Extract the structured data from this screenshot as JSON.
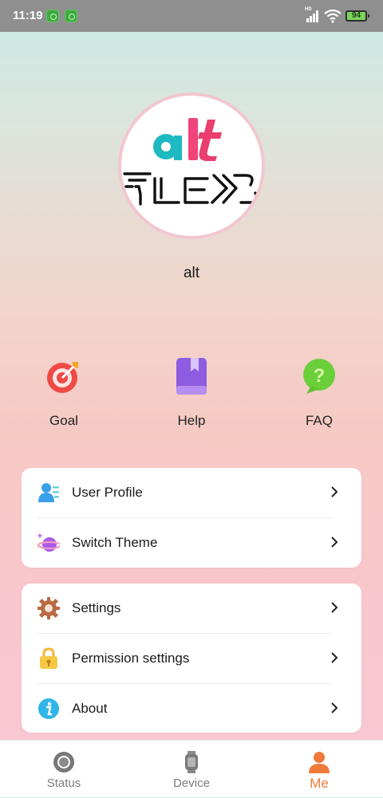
{
  "status_bar": {
    "time": "11:19",
    "hd": "HD",
    "battery": "94"
  },
  "profile": {
    "username": "alt",
    "logo_top_text": "alt",
    "logo_bottom_text": "FLEX"
  },
  "quick_actions": [
    {
      "label": "Goal",
      "icon": "target-icon"
    },
    {
      "label": "Help",
      "icon": "book-icon"
    },
    {
      "label": "FAQ",
      "icon": "question-bubble-icon"
    }
  ],
  "menu_group_1": [
    {
      "label": "User Profile",
      "icon": "user-profile-icon"
    },
    {
      "label": "Switch Theme",
      "icon": "planet-icon"
    }
  ],
  "menu_group_2": [
    {
      "label": "Settings",
      "icon": "gear-icon"
    },
    {
      "label": "Permission settings",
      "icon": "lock-icon"
    },
    {
      "label": "About",
      "icon": "info-icon"
    }
  ],
  "bottom_nav": [
    {
      "label": "Status",
      "icon": "status-ring-icon",
      "active": false
    },
    {
      "label": "Device",
      "icon": "watch-icon",
      "active": false
    },
    {
      "label": "Me",
      "icon": "person-icon",
      "active": true
    }
  ],
  "colors": {
    "accent": "#f07a3a",
    "goal_icon": "#ef4a45",
    "help_icon": "#8d5ce0",
    "faq_icon": "#6bcf3a",
    "about_icon": "#2fb6e8"
  }
}
